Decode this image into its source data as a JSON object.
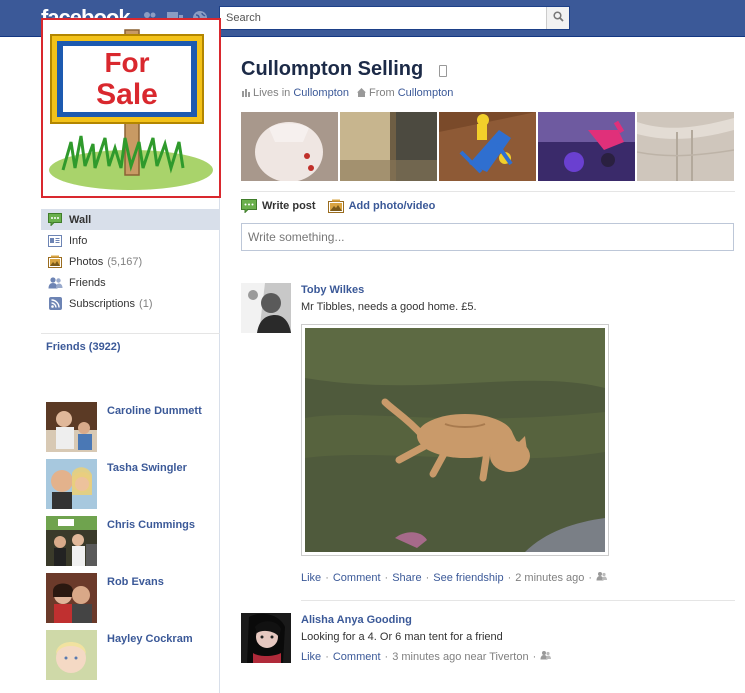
{
  "topbar": {
    "logo": "facebook",
    "search_placeholder": "Search"
  },
  "profile": {
    "picture_sign_text": [
      "For",
      "Sale"
    ],
    "name": "Cullompton Selling",
    "lives_in_label": "Lives in",
    "lives_in_value": "Cullompton",
    "from_label": "From",
    "from_value": "Cullompton"
  },
  "nav": {
    "items": [
      {
        "label": "Wall",
        "count": ""
      },
      {
        "label": "Info",
        "count": ""
      },
      {
        "label": "Photos",
        "count": "(5,167)"
      },
      {
        "label": "Friends",
        "count": ""
      },
      {
        "label": "Subscriptions",
        "count": "(1)"
      }
    ]
  },
  "friends": {
    "header": "Friends (3922)",
    "list": [
      "Caroline Dummett",
      "Tasha Swingler",
      "Chris Cummings",
      "Rob Evans",
      "Hayley Cockram"
    ]
  },
  "composer": {
    "write_post": "Write post",
    "add_photo": "Add photo/video",
    "placeholder": "Write something..."
  },
  "stories": [
    {
      "author": "Toby Wilkes",
      "text": "Mr Tibbles, needs a good home. £5.",
      "actions": [
        "Like",
        "Comment",
        "Share",
        "See friendship"
      ],
      "time": "2 minutes ago"
    },
    {
      "author": "Alisha Anya Gooding",
      "text": "Looking for a 4. Or 6 man tent for a friend",
      "actions": [
        "Like",
        "Comment"
      ],
      "time": "3 minutes ago near Tiverton"
    }
  ],
  "colors": {
    "brand": "#3b5998",
    "sign_red": "#d9282e"
  }
}
